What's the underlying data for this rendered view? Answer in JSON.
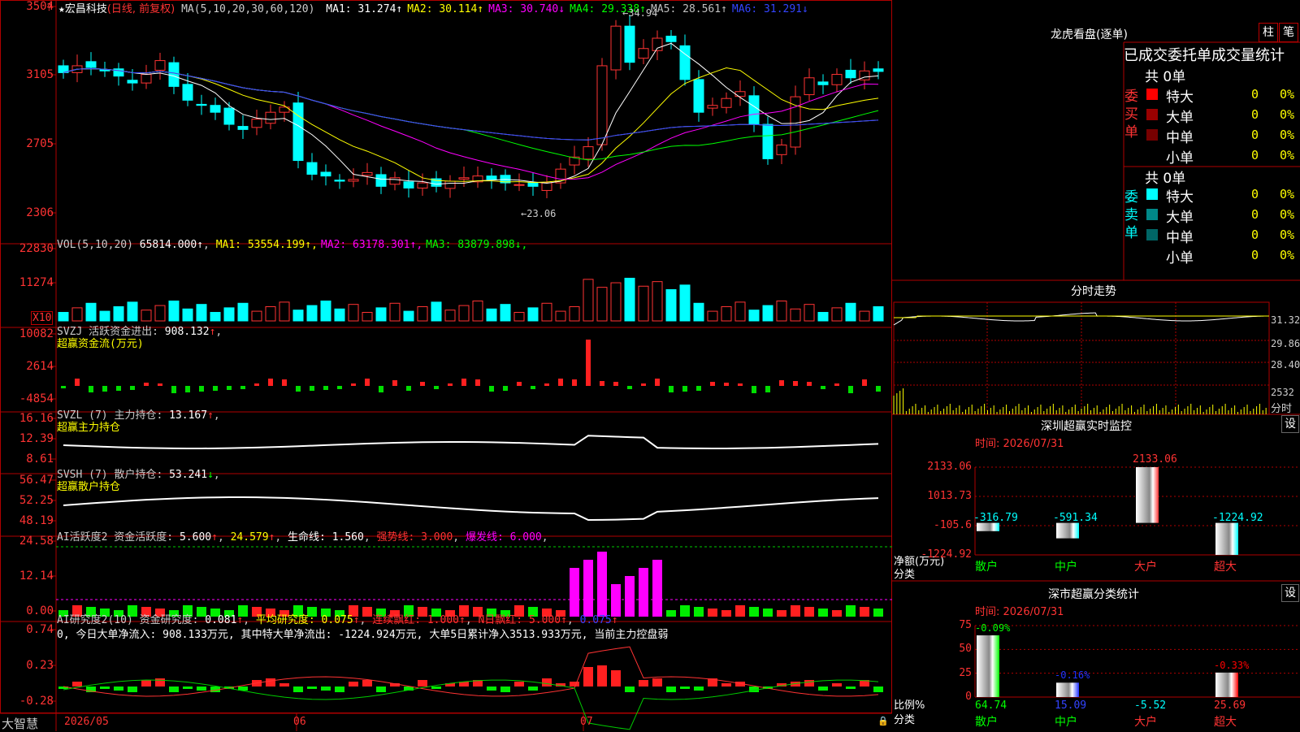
{
  "stock": {
    "star": "★",
    "name": "宏昌科技",
    "period": "(日线, 前复权)",
    "ma_label": "MA(5,10,20,30,60,120)",
    "ma": [
      {
        "label": "MA1:",
        "value": "31.274",
        "arrow": "↑",
        "color": "#ffffff"
      },
      {
        "label": "MA2:",
        "value": "30.114",
        "arrow": "↑",
        "color": "#ffff00"
      },
      {
        "label": "MA3:",
        "value": "30.740",
        "arrow": "↓",
        "color": "#ff00ff"
      },
      {
        "label": "MA4:",
        "value": "29.338",
        "arrow": "↑",
        "color": "#00ff00"
      },
      {
        "label": "MA5:",
        "value": "28.561",
        "arrow": "↑",
        "color": "#c0c0c0"
      },
      {
        "label": "MA6:",
        "value": "31.291",
        "arrow": "↓",
        "color": "#3344ff"
      }
    ],
    "axis": [
      "3504",
      "3105",
      "2705",
      "2306"
    ],
    "high_mark": "34.94",
    "low_mark": "←23.06",
    "corner": "?"
  },
  "vol": {
    "label": "VOL(5,10,20)",
    "value": "65814.000",
    "ma": [
      {
        "label": "MA1:",
        "value": "53554.199",
        "arrow": "↑",
        "color": "#ffff00"
      },
      {
        "label": "MA2:",
        "value": "63178.301",
        "arrow": "↑",
        "color": "#ff00ff"
      },
      {
        "label": "MA3:",
        "value": "83879.898",
        "arrow": "↓",
        "color": "#00ff00"
      }
    ],
    "axis": [
      "22830",
      "11274"
    ],
    "unit": "X10"
  },
  "svzj": {
    "label": "SVZJ  活跃资金进出:",
    "value": "908.132",
    "sub": "超赢资金流(万元)",
    "axis": [
      "10082",
      "2614",
      "-4854"
    ]
  },
  "svzl": {
    "label": "SVZL (7) 主力持仓:",
    "value": "13.167",
    "sub": "超赢主力持仓",
    "axis": [
      "16.16",
      "12.39",
      "8.61"
    ]
  },
  "svsh": {
    "label": "SVSH (7) 散户持仓:",
    "value": "53.241",
    "sub": "超赢散户持仓",
    "axis": [
      "56.47",
      "52.25",
      "48.19"
    ]
  },
  "ai1": {
    "label": "AI活跃度2 资金活跃度:",
    "value": "5.600",
    "v2": "24.579",
    "life_label": "生命线:",
    "life": "1.560",
    "strong": "强势线: 3.000",
    "burst": "爆发线: 6.000",
    "axis": [
      "24.58",
      "12.14",
      "0.00"
    ]
  },
  "ai2": {
    "label": "AI研究度2(10) 资金研究度:",
    "value": "0.081",
    "avg": "平均研究度: 0.075",
    "lian": "连续飘红: 1.000",
    "nday": "N日飘红: 5.000",
    "last": "0.075",
    "desc": "0, 今日大单净流入: 908.133万元, 其中特大单净流出: -1224.924万元, 大单5日累计净入3513.933万元, 当前主力控盘弱",
    "axis": [
      "0.74",
      "0.23",
      "-0.28"
    ]
  },
  "dates": [
    "2026/05",
    "06",
    "07"
  ],
  "brand": "大智慧",
  "right": {
    "lhb_title": "龙虎看盘(逐单)",
    "btn1": "柱",
    "btn2": "笔",
    "stat_title": "已成交委托单成交量统计",
    "buy_side": "委买单",
    "sell_side": "委卖单",
    "buy_total": "共 0单",
    "sell_total": "共 0单",
    "buy_rows": [
      {
        "label": "特大",
        "value": "0",
        "pct": "0%",
        "color": "#ff0000"
      },
      {
        "label": "大单",
        "value": "0",
        "pct": "0%",
        "color": "#990000"
      },
      {
        "label": "中单",
        "value": "0",
        "pct": "0%",
        "color": "#770000"
      },
      {
        "label": "小单",
        "value": "0",
        "pct": "0%",
        "color": ""
      }
    ],
    "sell_rows": [
      {
        "label": "特大",
        "value": "0",
        "pct": "0%",
        "color": "#00ffff"
      },
      {
        "label": "大单",
        "value": "0",
        "pct": "0%",
        "color": "#008888"
      },
      {
        "label": "中单",
        "value": "0",
        "pct": "0%",
        "color": "#006666"
      },
      {
        "label": "小单",
        "value": "0",
        "pct": "0%",
        "color": ""
      }
    ],
    "minute_title": "分时走势",
    "minute_axis": [
      "31.32",
      "29.86",
      "28.40",
      "2532"
    ],
    "minute_unit": "分时",
    "sz_title": "深圳超赢实时监控",
    "sz_set": "设",
    "sz_time": "时间: 2026/07/31",
    "sz_axis": [
      "2133.06",
      "1013.73",
      "-105.6",
      "-1224.92"
    ],
    "sz_unit": "净额(万元)",
    "sz_cat": "分类",
    "sz_bars": [
      {
        "label": "散户",
        "value": -316.79,
        "text": "-316.79"
      },
      {
        "label": "中户",
        "value": -591.34,
        "text": "-591.34"
      },
      {
        "label": "大户",
        "value": 2133.06,
        "text": "2133.06"
      },
      {
        "label": "超大",
        "value": -1224.92,
        "text": "-1224.92"
      }
    ],
    "cls_title": "深市超赢分类统计",
    "cls_set": "设",
    "cls_time": "时间: 2026/07/31",
    "cls_axis": [
      "75",
      "50",
      "25",
      "0"
    ],
    "cls_unit": "比例%",
    "cls_cat": "分类",
    "cls_bars": [
      {
        "label": "散户",
        "value": 64.74,
        "text": "64.74",
        "pct": "-0.09%",
        "color": "#00ff00"
      },
      {
        "label": "中户",
        "value": 15.09,
        "text": "15.09",
        "pct": "-0.16%",
        "color": "#2233ff"
      },
      {
        "label": "大户",
        "value": -5.52,
        "text": "-5.52",
        "pct": "",
        "color": "#ff0000"
      },
      {
        "label": "超大",
        "value": 25.69,
        "text": "25.69",
        "pct": "-0.33%",
        "color": "#ff0000"
      }
    ]
  },
  "chart_data": {
    "type": "candlestick",
    "title": "宏昌科技 (日线, 前复权)",
    "ylim": [
      23.06,
      35.04
    ],
    "high": 34.94,
    "low": 23.06,
    "dates": [
      "2026/05",
      "06",
      "07"
    ],
    "indicators": {
      "MA1": 31.274,
      "MA2": 30.114,
      "MA3": 30.74,
      "MA4": 29.338,
      "MA5": 28.561,
      "MA6": 31.291,
      "VOL": 65814.0,
      "VOL_MA1": 53554.199,
      "VOL_MA2": 63178.301,
      "VOL_MA3": 83879.898,
      "SVZJ": 908.132,
      "SVZL": 13.167,
      "SVSH": 53.241,
      "AI_active": 5.6,
      "AI_research": 0.081
    }
  }
}
